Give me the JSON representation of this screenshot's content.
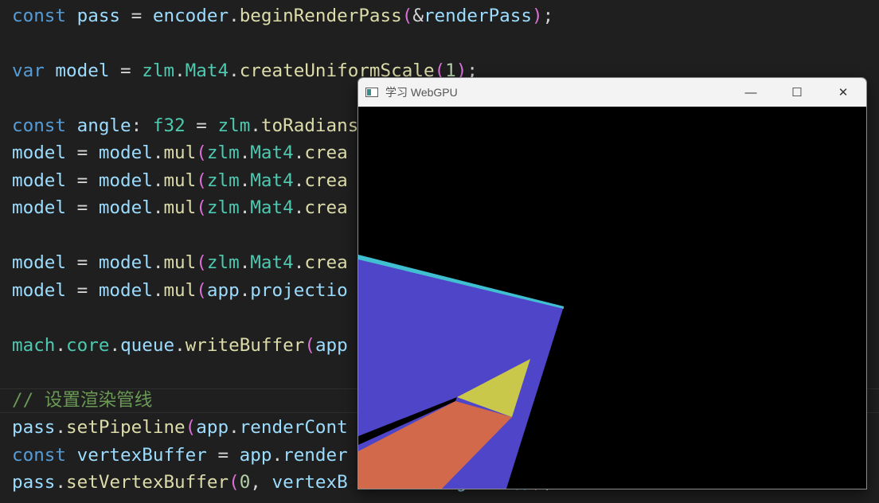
{
  "editor": {
    "lines": [
      {
        "tokens": [
          [
            "const",
            "kw"
          ],
          [
            " ",
            "txt"
          ],
          [
            "pass",
            "var"
          ],
          [
            " = ",
            "txt"
          ],
          [
            "encoder",
            "var"
          ],
          [
            ".",
            "txt"
          ],
          [
            "beginRenderPass",
            "fn"
          ],
          [
            "(",
            "par"
          ],
          [
            "&",
            "txt"
          ],
          [
            "renderPass",
            "var"
          ],
          [
            ")",
            "par"
          ],
          [
            ";",
            "txt"
          ]
        ]
      },
      {
        "tokens": [
          [
            "var",
            "kw"
          ],
          [
            " ",
            "txt"
          ],
          [
            "model",
            "var"
          ],
          [
            " = ",
            "txt"
          ],
          [
            "zlm",
            "typ"
          ],
          [
            ".",
            "txt"
          ],
          [
            "Mat4",
            "typ"
          ],
          [
            ".",
            "txt"
          ],
          [
            "createUniformScale",
            "fn"
          ],
          [
            "(",
            "par"
          ],
          [
            "1",
            "num"
          ],
          [
            ")",
            "par"
          ],
          [
            ";",
            "txt"
          ]
        ]
      },
      {
        "tokens": [
          [
            "const",
            "kw"
          ],
          [
            " ",
            "txt"
          ],
          [
            "angle",
            "var"
          ],
          [
            ": ",
            "txt"
          ],
          [
            "f32",
            "typ"
          ],
          [
            " = ",
            "txt"
          ],
          [
            "zlm",
            "typ"
          ],
          [
            ".",
            "txt"
          ],
          [
            "toRadians",
            "fn"
          ]
        ]
      },
      {
        "tokens": [
          [
            "model",
            "var"
          ],
          [
            " = ",
            "txt"
          ],
          [
            "model",
            "var"
          ],
          [
            ".",
            "txt"
          ],
          [
            "mul",
            "fn"
          ],
          [
            "(",
            "par"
          ],
          [
            "zlm",
            "typ"
          ],
          [
            ".",
            "txt"
          ],
          [
            "Mat4",
            "typ"
          ],
          [
            ".",
            "txt"
          ],
          [
            "crea",
            "fn"
          ]
        ]
      },
      {
        "tokens": [
          [
            "model",
            "var"
          ],
          [
            " = ",
            "txt"
          ],
          [
            "model",
            "var"
          ],
          [
            ".",
            "txt"
          ],
          [
            "mul",
            "fn"
          ],
          [
            "(",
            "par"
          ],
          [
            "zlm",
            "typ"
          ],
          [
            ".",
            "txt"
          ],
          [
            "Mat4",
            "typ"
          ],
          [
            ".",
            "txt"
          ],
          [
            "crea",
            "fn"
          ]
        ]
      },
      {
        "tokens": [
          [
            "model",
            "var"
          ],
          [
            " = ",
            "txt"
          ],
          [
            "model",
            "var"
          ],
          [
            ".",
            "txt"
          ],
          [
            "mul",
            "fn"
          ],
          [
            "(",
            "par"
          ],
          [
            "zlm",
            "typ"
          ],
          [
            ".",
            "txt"
          ],
          [
            "Mat4",
            "typ"
          ],
          [
            ".",
            "txt"
          ],
          [
            "crea",
            "fn"
          ]
        ]
      },
      {
        "tokens": [
          [
            "model",
            "var"
          ],
          [
            " = ",
            "txt"
          ],
          [
            "model",
            "var"
          ],
          [
            ".",
            "txt"
          ],
          [
            "mul",
            "fn"
          ],
          [
            "(",
            "par"
          ],
          [
            "zlm",
            "typ"
          ],
          [
            ".",
            "txt"
          ],
          [
            "Mat4",
            "typ"
          ],
          [
            ".",
            "txt"
          ],
          [
            "crea",
            "fn"
          ]
        ]
      },
      {
        "tokens": [
          [
            "model",
            "var"
          ],
          [
            " = ",
            "txt"
          ],
          [
            "model",
            "var"
          ],
          [
            ".",
            "txt"
          ],
          [
            "mul",
            "fn"
          ],
          [
            "(",
            "par"
          ],
          [
            "app",
            "var"
          ],
          [
            ".",
            "txt"
          ],
          [
            "projectio",
            "var"
          ]
        ]
      },
      {
        "tokens": [
          [
            "mach",
            "typ"
          ],
          [
            ".",
            "txt"
          ],
          [
            "core",
            "typ"
          ],
          [
            ".",
            "txt"
          ],
          [
            "queue",
            "var"
          ],
          [
            ".",
            "txt"
          ],
          [
            "writeBuffer",
            "fn"
          ],
          [
            "(",
            "par"
          ],
          [
            "app",
            "var"
          ]
        ]
      },
      {
        "tokens": [
          [
            "// 设置渲染管线",
            "cmt"
          ]
        ]
      },
      {
        "tokens": [
          [
            "pass",
            "var"
          ],
          [
            ".",
            "txt"
          ],
          [
            "setPipeline",
            "fn"
          ],
          [
            "(",
            "par"
          ],
          [
            "app",
            "var"
          ],
          [
            ".",
            "txt"
          ],
          [
            "renderCont",
            "var"
          ]
        ]
      },
      {
        "tokens": [
          [
            "const",
            "kw"
          ],
          [
            " ",
            "txt"
          ],
          [
            "vertexBuffer",
            "var"
          ],
          [
            " = ",
            "txt"
          ],
          [
            "app",
            "var"
          ],
          [
            ".",
            "txt"
          ],
          [
            "render",
            "var"
          ]
        ]
      },
      {
        "tokens": [
          [
            "pass",
            "var"
          ],
          [
            ".",
            "txt"
          ],
          [
            "setVertexBuffer",
            "fn"
          ],
          [
            "(",
            "par"
          ],
          [
            "0",
            "num"
          ],
          [
            ", ",
            "txt"
          ],
          [
            "vertexB",
            "var"
          ],
          [
            "          ",
            "txt"
          ],
          [
            "g",
            "var"
          ],
          [
            "    ",
            "txt"
          ],
          [
            "()",
            "par2"
          ],
          [
            ")",
            "par"
          ],
          [
            ";",
            "txt"
          ]
        ]
      }
    ]
  },
  "window": {
    "title": "学习 WebGPU",
    "controls": {
      "minimize": "—",
      "maximize": "☐",
      "close": "✕"
    }
  },
  "colors": {
    "background": "#1f1f1f",
    "face_blue": "#4f45c8",
    "face_yellow": "#c9c84a",
    "face_orange": "#d2694a",
    "edge_cyan": "#3fbfd0"
  }
}
